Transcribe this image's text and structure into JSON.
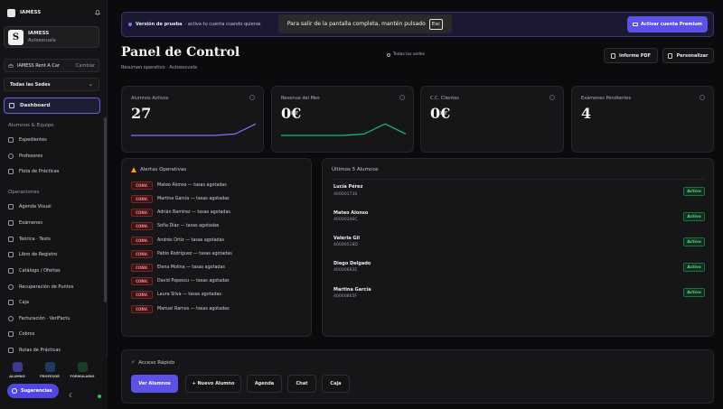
{
  "app": {
    "brand": "IAMESS"
  },
  "org": {
    "name": "IAMESS",
    "subtitle": "Autoescuela"
  },
  "rent": {
    "name": "IAMESS Rent A Car",
    "change": "Cambiar"
  },
  "sedes": {
    "selected": "Todas las Sedes"
  },
  "nav": {
    "dashboard": "Dashboard",
    "section1": "Alumnos & Equipo",
    "items1": [
      "Expedientes",
      "Profesores",
      "Flota de Prácticas"
    ],
    "section2": "Operaciones",
    "items2": [
      "Agenda Visual",
      "Exámenes",
      "Teórica · Tests",
      "Libro de Registro",
      "Catálogo / Ofertas",
      "Recuperación de Puntos",
      "Caja",
      "Facturación · VeriFactu",
      "Cobros",
      "Rutas de Prácticas"
    ]
  },
  "roles": [
    {
      "label": "ALUMNO",
      "color": "#3b3b8f"
    },
    {
      "label": "PROFESOR",
      "color": "#1e3a5f"
    },
    {
      "label": "FORMULARIO",
      "color": "#1a3d28"
    }
  ],
  "suggestions": "Sugerencias",
  "trial": {
    "bold": "Versión de prueba",
    "text": "· activa tu cuenta cuando quieras"
  },
  "fullscreen": {
    "text": "Para salir de la pantalla completa, mantén pulsado",
    "key": "Esc"
  },
  "premium": "Activar cuenta Premium",
  "header": {
    "title": "Panel de Control",
    "subtitle": "Resumen operativo · Autoescuela",
    "all_sedes": "Todas las sedes",
    "pdf": "Informe PDF",
    "customize": "Personalizar"
  },
  "kpis": [
    {
      "label": "Alumnos Activos",
      "value": "27",
      "color": "#7c72ff",
      "trend": [
        0,
        0,
        0,
        0,
        0,
        0.1,
        0.8
      ]
    },
    {
      "label": "Revenue del Mes",
      "value": "0€",
      "color": "#10b981",
      "trend": [
        0,
        0,
        0,
        0,
        0.1,
        0.8,
        0.1
      ]
    },
    {
      "label": "C.C. Clientes",
      "value": "0€",
      "color": "#6b7280",
      "trend": []
    },
    {
      "label": "Exámenes Pendientes",
      "value": "4",
      "color": "#6b7280",
      "trend": []
    }
  ],
  "alerts": {
    "title": "Alertas Operativas",
    "badge": "CONV.",
    "items": [
      "Mateo Alonso — tasas agotadas",
      "Martina García — tasas agotadas",
      "Adrián Ramírez — tasas agotadas",
      "Sofía Díaz — tasas agotadas",
      "Andrés Ortiz — tasas agotadas",
      "Pablo Rodríguez — tasas agotadas",
      "Elena Molina — tasas agotadas",
      "David Popescu — tasas agotadas",
      "Laura Silva — tasas agotadas",
      "Manuel Ramos — tasas agotadas"
    ]
  },
  "students": {
    "title": "Últimos 5 Alumnos",
    "items": [
      {
        "name": "Lucía Pérez",
        "id": "40000173S",
        "status": "Activo"
      },
      {
        "name": "Mateo Alonso",
        "id": "40000346C",
        "status": "Activo"
      },
      {
        "name": "Valeria Gil",
        "id": "40000518D",
        "status": "Activo"
      },
      {
        "name": "Diego Delgado",
        "id": "40000692E",
        "status": "Activo"
      },
      {
        "name": "Martina García",
        "id": "40000865F",
        "status": "Activo"
      }
    ]
  },
  "quick": {
    "title": "Acceso Rápido",
    "buttons": [
      "Ver Alumnos",
      "+ Nuevo Alumno",
      "Agenda",
      "Chat",
      "Caja"
    ]
  }
}
